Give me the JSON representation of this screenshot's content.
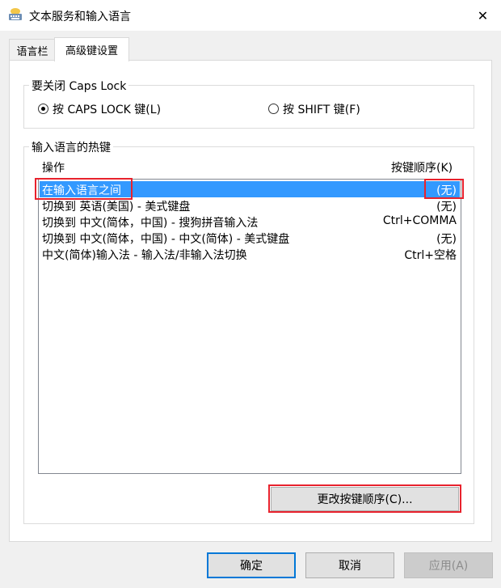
{
  "window": {
    "title": "文本服务和输入语言",
    "close_glyph": "✕"
  },
  "tabs": [
    {
      "label": "语言栏",
      "active": false
    },
    {
      "label": "高级键设置",
      "active": true
    }
  ],
  "caps_lock": {
    "group_label": "要关闭 Caps Lock",
    "option_caps_label": "按 CAPS LOCK 键(L)",
    "option_shift_label": "按 SHIFT 键(F)",
    "selected": "caps"
  },
  "hotkeys": {
    "group_label": "输入语言的热键",
    "col_action": "操作",
    "col_key_sequence": "按键顺序(K)",
    "rows": [
      {
        "action": "在输入语言之间",
        "key": "(无)",
        "selected": true
      },
      {
        "action": "切换到 英语(美国) - 美式键盘",
        "key": "(无)",
        "selected": false
      },
      {
        "action": "切换到 中文(简体，中国) - 搜狗拼音输入法",
        "key": "Ctrl+COMMA",
        "selected": false
      },
      {
        "action": "切换到 中文(简体，中国) - 中文(简体) - 美式键盘",
        "key": "(无)",
        "selected": false
      },
      {
        "action": "中文(简体)输入法 - 输入法/非输入法切换",
        "key": "Ctrl+空格",
        "selected": false
      }
    ],
    "change_button_label": "更改按键顺序(C)..."
  },
  "footer": {
    "ok_label": "确定",
    "cancel_label": "取消",
    "apply_label": "应用(A)"
  },
  "colors": {
    "selection": "#3399ff",
    "annotation_box": "#e8222d",
    "default_button_border": "#0078d7"
  }
}
